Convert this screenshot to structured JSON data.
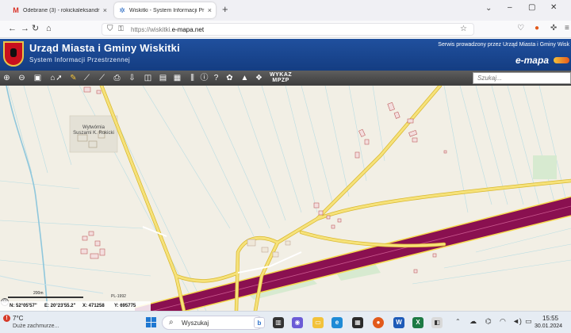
{
  "browser": {
    "tabs": [
      {
        "title": "Odebrane (3) - rokickaleksandr",
        "favicon": "gmail-icon"
      },
      {
        "title": "Wiskitki - System Informacji Pr",
        "favicon": "emapa-icon"
      }
    ],
    "new_tab_glyph": "+",
    "url_prefix": "https://wiskitki.",
    "url_domain": "e-mapa.net",
    "window_controls": [
      "–",
      "▢",
      "✕"
    ]
  },
  "site": {
    "title": "Urząd Miasta i Gminy Wiskitki",
    "subtitle": "System Informacji Przestrzennej",
    "service_note": "Serwis prowadzony przez Urząd Miasta i Gminy Wisk",
    "logo": "e-mapa",
    "brand_color": "#1a4a96"
  },
  "toolbar": {
    "wykaz_line1": "WYKAZ",
    "wykaz_line2": "MPZP",
    "search_placeholder": "Szukaj...",
    "tools": [
      "zoom-in-icon",
      "zoom-out-icon",
      "zoom-extent-icon",
      "pointer-icon",
      "pencil-icon",
      "measure-line-icon",
      "measure-link-icon",
      "print-icon",
      "download-icon",
      "layers-icon",
      "bus-icon",
      "grid-icon",
      "info-icon",
      "help-icon",
      "settings-icon",
      "triangle-icon",
      "cluster-icon"
    ]
  },
  "map": {
    "label": "Wytwórnia Suszarni K. Rokicki",
    "scale": "200m",
    "projection": "PL-1992",
    "coords": {
      "n": "N: 52°05'57\"",
      "e": "E: 20°23'55.2\"",
      "x": "X: 471258",
      "y": "Y: 695775"
    },
    "colors": {
      "background": "#f2efe5",
      "road_yellow": "#f6d94e",
      "highway": "#8a1050",
      "building_outline": "#c06060",
      "field_lines": "#a7d3dc",
      "green": "#d8ecd0"
    }
  },
  "taskbar": {
    "weather_temp": "7°C",
    "weather_desc": "Duże zachmurze...",
    "search_label": "Wyszukaj",
    "time": "15:55",
    "date": "30.01.2024"
  }
}
